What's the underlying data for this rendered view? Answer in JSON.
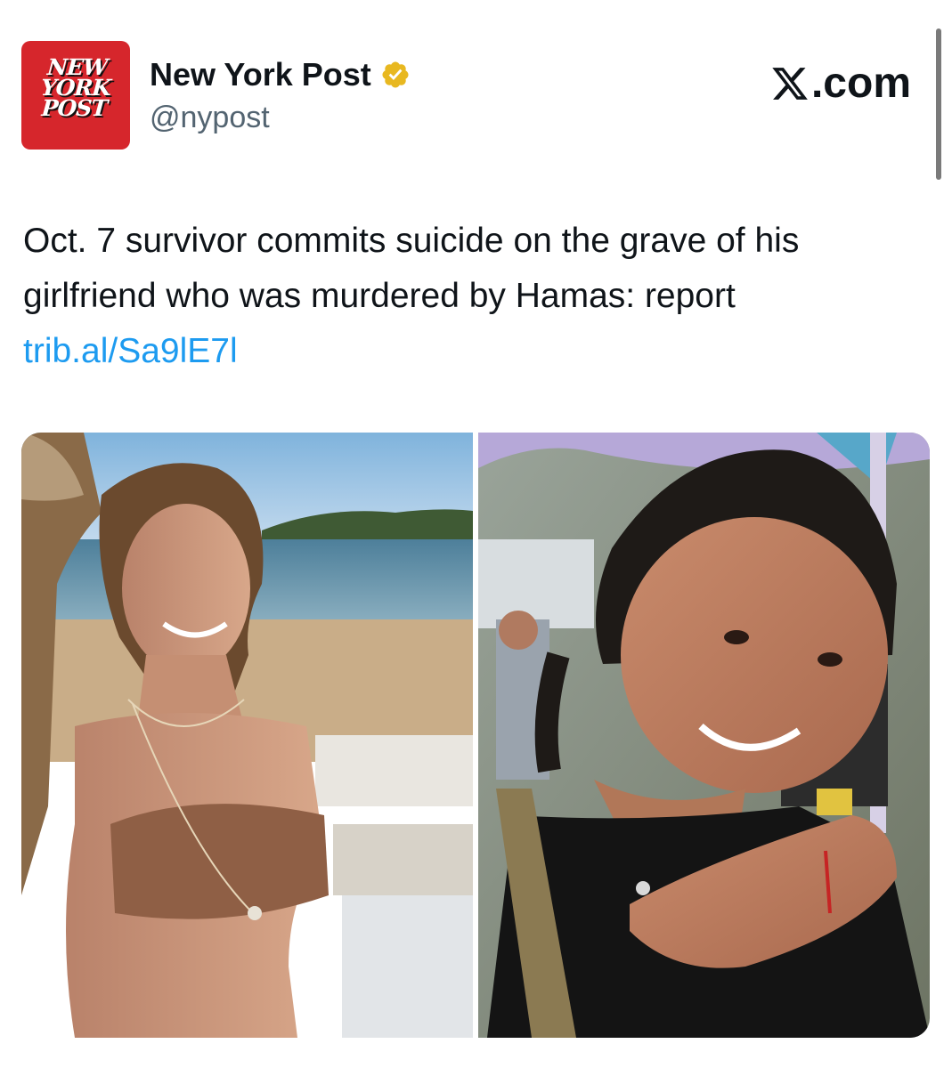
{
  "header": {
    "avatar_lines": [
      "NEW",
      "YORK",
      "POST"
    ],
    "display_name": "New York Post",
    "handle": "@nypost",
    "brand": ".com"
  },
  "tweet": {
    "text": "Oct. 7 survivor commits suicide on the grave of his girlfriend who was murdered by Hamas: report",
    "link": "trib.al/Sa9lE7l"
  },
  "colors": {
    "avatar_bg": "#d6262c",
    "verified_badge": "#e8b820",
    "link": "#1d9bf0",
    "handle": "#536471"
  },
  "media": {
    "photos": [
      "beach-portrait-photo",
      "festival-portrait-photo"
    ]
  }
}
